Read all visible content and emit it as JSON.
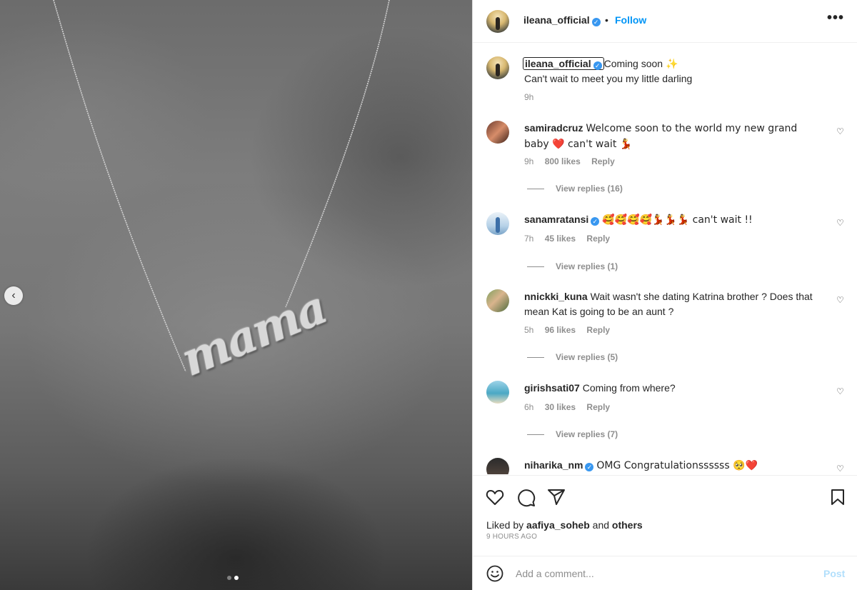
{
  "post": {
    "pendant_text": "mama",
    "carousel": {
      "prev_icon": "chevron-left-icon",
      "dots": 2,
      "active_dot": 2
    }
  },
  "header": {
    "username": "ileana_official",
    "verified": true,
    "separator": "•",
    "follow_label": "Follow",
    "more_icon": "more-horizontal-icon"
  },
  "caption": {
    "username": "ileana_official",
    "line1": "Coming soon ✨",
    "line2": "Can't wait to meet you my little darling",
    "time": "9h"
  },
  "comments": [
    {
      "username": "samiradcruz",
      "verified": false,
      "text": "Welcome soon to the world my new grand baby ❤️ can't wait 💃",
      "time": "9h",
      "likes": "800 likes",
      "reply": "Reply",
      "view_replies": "View replies (16)"
    },
    {
      "username": "sanamratansi",
      "verified": true,
      "text": "🥰🥰🥰🥰💃💃💃 can't wait !!",
      "time": "7h",
      "likes": "45 likes",
      "reply": "Reply",
      "view_replies": "View replies (1)"
    },
    {
      "username": "nnickki_kuna",
      "verified": false,
      "text": "Wait wasn't she dating Katrina brother ? Does that mean Kat is going to be an aunt ?",
      "time": "5h",
      "likes": "96 likes",
      "reply": "Reply",
      "view_replies": "View replies (5)"
    },
    {
      "username": "girishsati07",
      "verified": false,
      "text": "Coming from where?",
      "time": "6h",
      "likes": "30 likes",
      "reply": "Reply",
      "view_replies": "View replies (7)"
    },
    {
      "username": "niharika_nm",
      "verified": true,
      "text": "OMG Congratulationssssss 🥺❤️"
    }
  ],
  "actions": {
    "like_icon": "heart-icon",
    "comment_icon": "comment-icon",
    "share_icon": "send-icon",
    "save_icon": "bookmark-icon"
  },
  "likes": {
    "prefix": "Liked by",
    "user": "aafiya_soheb",
    "and": "and",
    "others": "others"
  },
  "timestamp": "9 HOURS AGO",
  "add_comment": {
    "placeholder": "Add a comment...",
    "post_label": "Post",
    "emoji_icon": "smiley-icon"
  },
  "colors": {
    "link": "#0095f6",
    "verified": "#3897f0",
    "post_disabled": "#b2dffc",
    "heart_red": "#ed4956"
  }
}
